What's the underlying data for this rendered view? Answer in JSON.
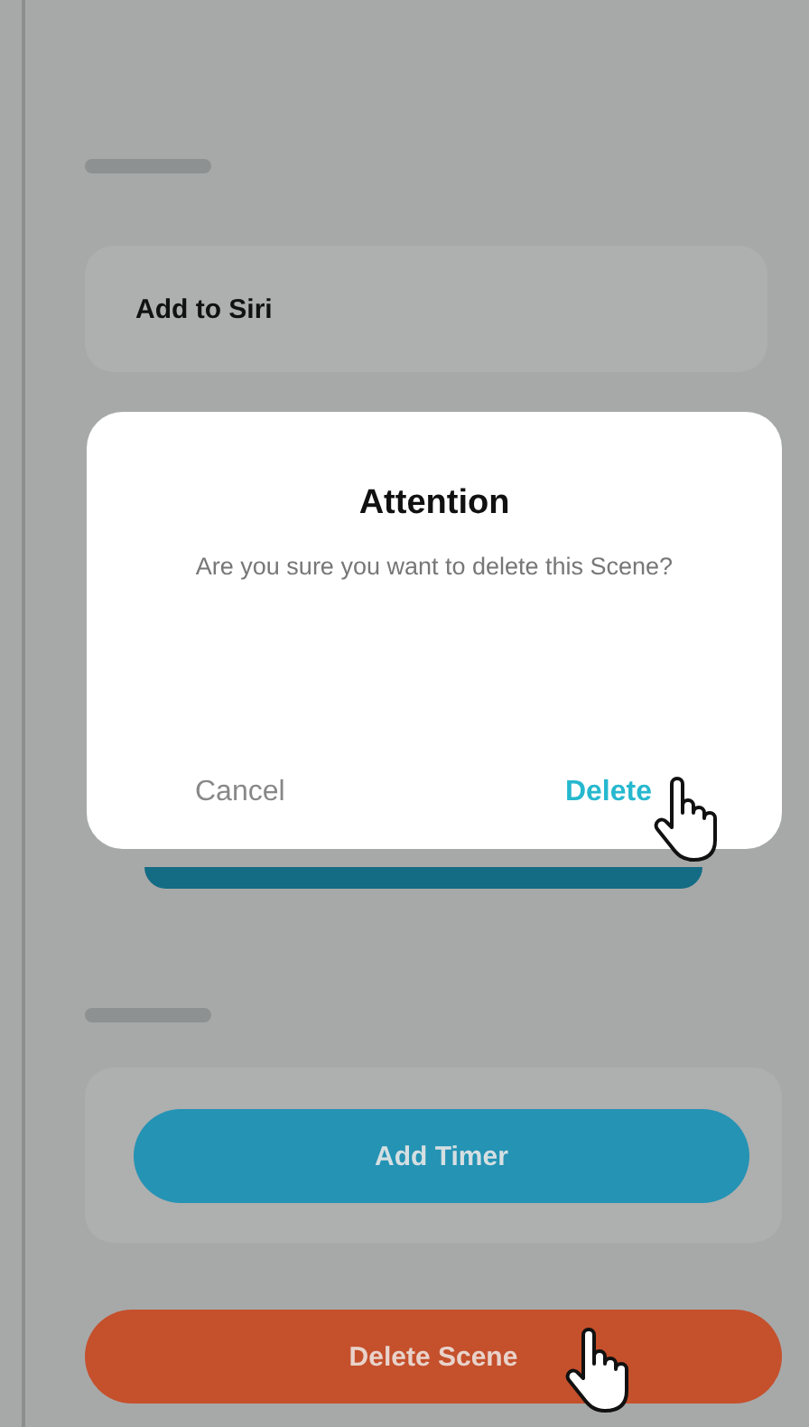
{
  "screen": {
    "siri_card": {
      "label": "Add to Siri"
    },
    "timer_button": {
      "label": "Add Timer"
    },
    "delete_button": {
      "label": "Delete Scene"
    }
  },
  "dialog": {
    "title": "Attention",
    "message": "Are you sure you want to delete this Scene?",
    "buttons": [
      {
        "label": "Cancel",
        "kind": "cancel"
      },
      {
        "label": "Delete",
        "kind": "confirm"
      }
    ]
  }
}
